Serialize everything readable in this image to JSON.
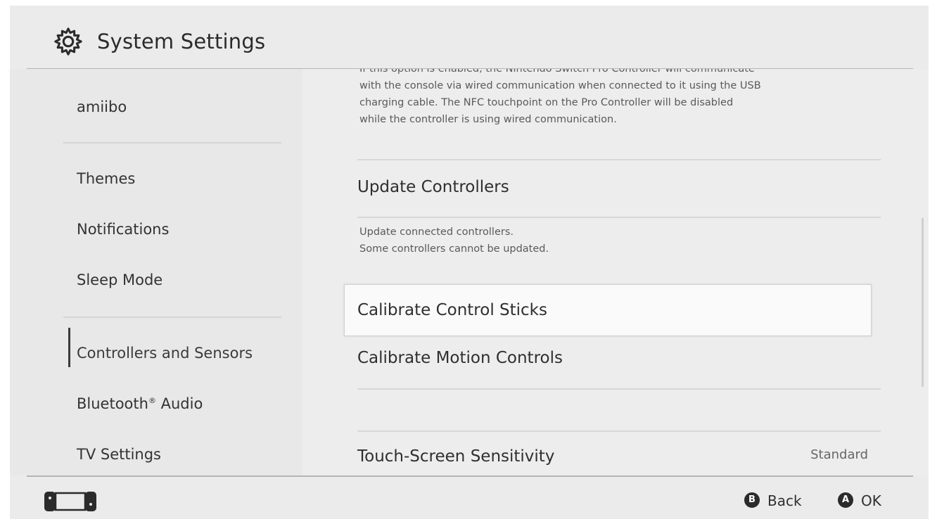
{
  "header": {
    "title": "System Settings",
    "icon": "gear-icon"
  },
  "sidebar": {
    "items": [
      {
        "label": "amiibo",
        "active": false
      },
      {
        "label": "Themes",
        "active": false
      },
      {
        "label": "Notifications",
        "active": false
      },
      {
        "label": "Sleep Mode",
        "active": false
      },
      {
        "label": "Controllers and Sensors",
        "active": true
      },
      {
        "label": "Bluetooth",
        "suffix": "®",
        "label2": " Audio",
        "active": false
      },
      {
        "label": "TV Settings",
        "active": false
      }
    ]
  },
  "content": {
    "top_description": [
      "If this option is enabled, the Nintendo Switch Pro Controller will communicate",
      "with the console via wired communication when connected to it using the USB",
      "charging cable. The NFC touchpoint on the Pro Controller will be disabled",
      "while the controller is using wired communication."
    ],
    "update_controllers": {
      "label": "Update Controllers",
      "description": [
        "Update connected controllers.",
        "Some controllers cannot be updated."
      ]
    },
    "calibrate_sticks": {
      "label": "Calibrate Control Sticks",
      "selected": true
    },
    "calibrate_motion": {
      "label": "Calibrate Motion Controls"
    },
    "touch_screen": {
      "label": "Touch-Screen Sensitivity",
      "value": "Standard"
    }
  },
  "footer": {
    "back": {
      "button": "B",
      "label": "Back"
    },
    "ok": {
      "button": "A",
      "label": "OK"
    }
  },
  "colors": {
    "background": "#ebebeb",
    "text": "#2d2d2d",
    "selected_bg": "#fafafa"
  }
}
